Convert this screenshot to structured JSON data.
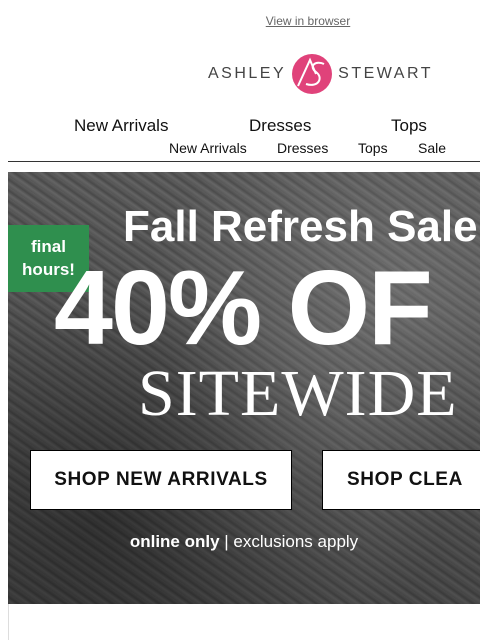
{
  "header": {
    "view_in_browser": "View in browser",
    "logo": {
      "left_text": "ASHLEY",
      "right_text": "STEWART",
      "monogram": "AS",
      "color": "#e0427a"
    }
  },
  "nav_primary": [
    "New Arrivals",
    "Dresses",
    "Tops"
  ],
  "nav_secondary": [
    "New Arrivals",
    "Dresses",
    "Tops",
    "Sale"
  ],
  "hero": {
    "tag": "final hours!",
    "headline": "Fall Refresh Sale",
    "offer": "40% OF",
    "offer_sub": "SITEWIDE",
    "buttons": [
      "SHOP NEW ARRIVALS",
      "SHOP CLEA"
    ],
    "footnote_bold": "online only",
    "footnote_rest": "| exclusions apply",
    "tag_color": "#2f8f4e"
  }
}
